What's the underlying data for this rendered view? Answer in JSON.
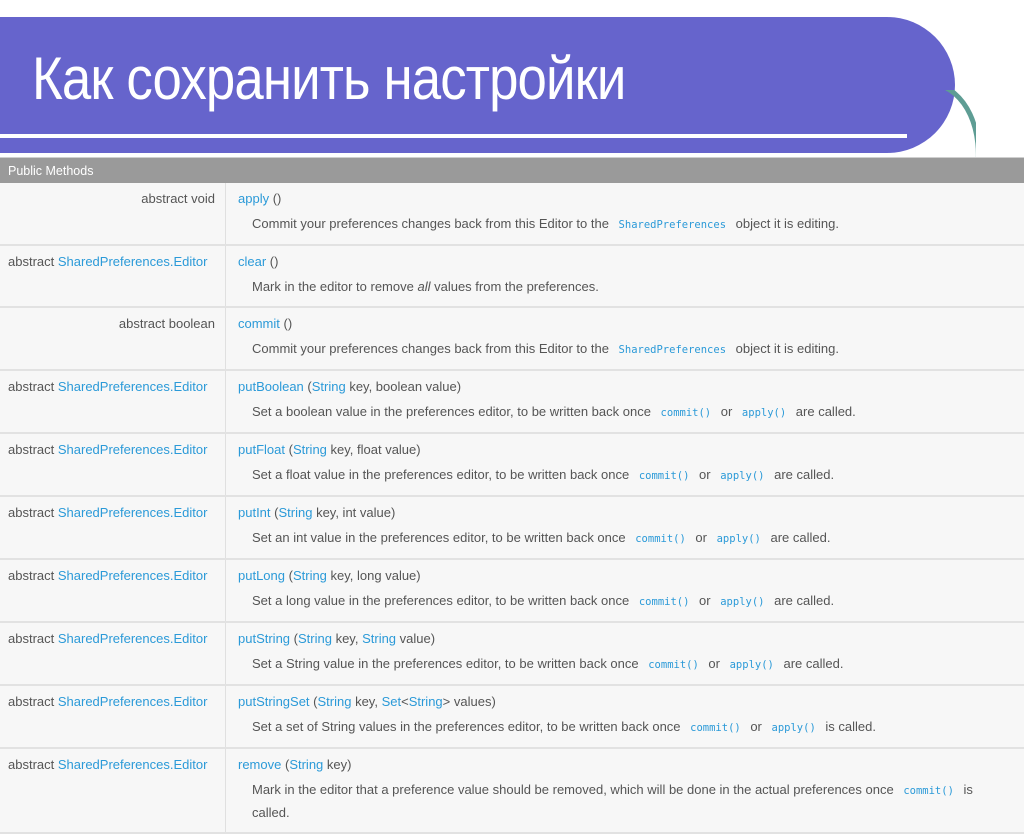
{
  "slide": {
    "title": "Как сохранить настройки"
  },
  "table": {
    "header": "Public Methods",
    "rows": [
      {
        "type_prefix": "abstract void",
        "type_link": "",
        "align": "right",
        "method": "apply",
        "params": [],
        "desc": [
          {
            "t": "Commit your preferences changes back from this Editor to the "
          },
          {
            "c": "SharedPreferences"
          },
          {
            "t": " object it is editing."
          }
        ]
      },
      {
        "type_prefix": "abstract ",
        "type_link": "SharedPreferences.Editor",
        "align": "left",
        "method": "clear",
        "params": [],
        "desc": [
          {
            "t": "Mark in the editor to remove "
          },
          {
            "i": "all"
          },
          {
            "t": " values from the preferences."
          }
        ]
      },
      {
        "type_prefix": "abstract boolean",
        "type_link": "",
        "align": "right",
        "method": "commit",
        "params": [],
        "desc": [
          {
            "t": "Commit your preferences changes back from this Editor to the "
          },
          {
            "c": "SharedPreferences"
          },
          {
            "t": " object it is editing."
          }
        ]
      },
      {
        "type_prefix": "abstract ",
        "type_link": "SharedPreferences.Editor",
        "align": "left",
        "method": "putBoolean",
        "params": [
          {
            "l": "String"
          },
          {
            "t": " key, boolean value"
          }
        ],
        "desc": [
          {
            "t": "Set a boolean value in the preferences editor, to be written back once "
          },
          {
            "c": "commit()"
          },
          {
            "t": " or "
          },
          {
            "c": "apply()"
          },
          {
            "t": " are called."
          }
        ]
      },
      {
        "type_prefix": "abstract ",
        "type_link": "SharedPreferences.Editor",
        "align": "left",
        "method": "putFloat",
        "params": [
          {
            "l": "String"
          },
          {
            "t": " key, float value"
          }
        ],
        "desc": [
          {
            "t": "Set a float value in the preferences editor, to be written back once "
          },
          {
            "c": "commit()"
          },
          {
            "t": " or "
          },
          {
            "c": "apply()"
          },
          {
            "t": " are called."
          }
        ]
      },
      {
        "type_prefix": "abstract ",
        "type_link": "SharedPreferences.Editor",
        "align": "left",
        "method": "putInt",
        "params": [
          {
            "l": "String"
          },
          {
            "t": " key, int value"
          }
        ],
        "desc": [
          {
            "t": "Set an int value in the preferences editor, to be written back once "
          },
          {
            "c": "commit()"
          },
          {
            "t": " or "
          },
          {
            "c": "apply()"
          },
          {
            "t": " are called."
          }
        ]
      },
      {
        "type_prefix": "abstract ",
        "type_link": "SharedPreferences.Editor",
        "align": "left",
        "method": "putLong",
        "params": [
          {
            "l": "String"
          },
          {
            "t": " key, long value"
          }
        ],
        "desc": [
          {
            "t": "Set a long value in the preferences editor, to be written back once "
          },
          {
            "c": "commit()"
          },
          {
            "t": " or "
          },
          {
            "c": "apply()"
          },
          {
            "t": " are called."
          }
        ]
      },
      {
        "type_prefix": "abstract ",
        "type_link": "SharedPreferences.Editor",
        "align": "left",
        "method": "putString",
        "params": [
          {
            "l": "String"
          },
          {
            "t": " key, "
          },
          {
            "l": "String"
          },
          {
            "t": " value"
          }
        ],
        "desc": [
          {
            "t": "Set a String value in the preferences editor, to be written back once "
          },
          {
            "c": "commit()"
          },
          {
            "t": " or "
          },
          {
            "c": "apply()"
          },
          {
            "t": " are called."
          }
        ]
      },
      {
        "type_prefix": "abstract ",
        "type_link": "SharedPreferences.Editor",
        "align": "left",
        "method": "putStringSet",
        "params": [
          {
            "l": "String"
          },
          {
            "t": " key, "
          },
          {
            "l": "Set"
          },
          {
            "t": "<"
          },
          {
            "l": "String"
          },
          {
            "t": "> values"
          }
        ],
        "desc": [
          {
            "t": "Set a set of String values in the preferences editor, to be written back once "
          },
          {
            "c": "commit()"
          },
          {
            "t": " or "
          },
          {
            "c": "apply()"
          },
          {
            "t": " is called."
          }
        ]
      },
      {
        "type_prefix": "abstract ",
        "type_link": "SharedPreferences.Editor",
        "align": "left",
        "method": "remove",
        "params": [
          {
            "l": "String"
          },
          {
            "t": " key"
          }
        ],
        "desc": [
          {
            "t": "Mark in the editor that a preference value should be removed, which will be done in the actual preferences once "
          },
          {
            "c": "commit()"
          },
          {
            "t": " is called."
          }
        ]
      }
    ]
  }
}
